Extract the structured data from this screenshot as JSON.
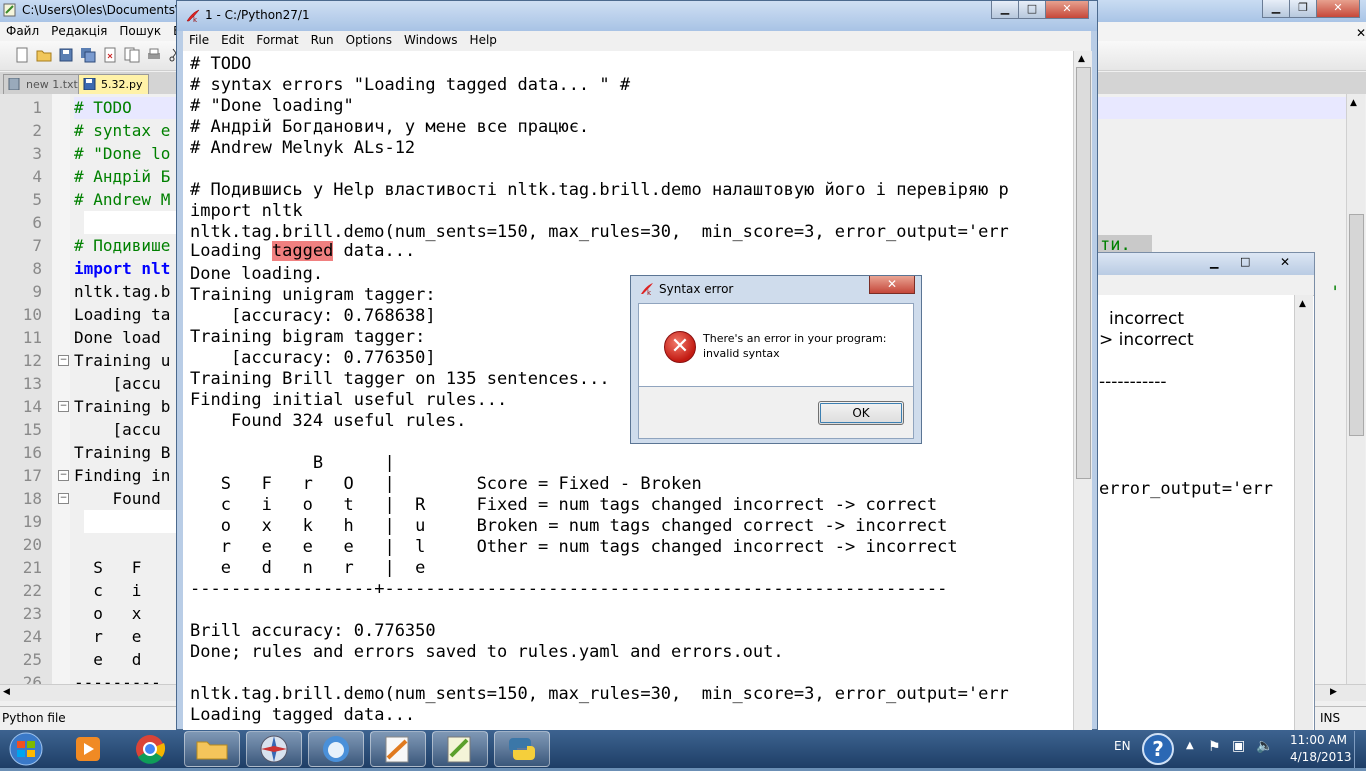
{
  "notepad": {
    "title": "C:\\Users\\Oles\\Documents\\Gi",
    "menu": [
      "Файл",
      "Редакція",
      "Пошук",
      "Ви"
    ],
    "tabs": [
      {
        "label": "new 1.txt"
      },
      {
        "label": "5.32.py"
      }
    ],
    "line_numbers": [
      "1",
      "2",
      "3",
      "4",
      "5",
      "6",
      "7",
      "8",
      "9",
      "10",
      "11",
      "12",
      "13",
      "14",
      "15",
      "16",
      "17",
      "18",
      "19",
      "20",
      "21",
      "22",
      "23",
      "24",
      "25",
      "26"
    ],
    "code_lines": [
      "# TODO",
      "# syntax e",
      "# \"Done lo",
      "# Андрій Б",
      "# Andrew M",
      "",
      "# Подивише",
      "import nlt",
      "nltk.tag.b",
      "Loading ta",
      "Done load",
      "Training u",
      "    [accu",
      "Training b",
      "    [accu",
      "Training B",
      "Finding in",
      "    Found",
      "",
      "",
      "  S   F",
      "  c   i",
      "  o   x",
      "  r   e",
      "  e   d",
      "---------"
    ],
    "status_left": "Python file",
    "status_right": "INS"
  },
  "shell2": {
    "lines": [
      "ти.",
      "'",
      "incorrect",
      "> incorrect",
      "-----------",
      "error_output='err"
    ]
  },
  "idle": {
    "title": "1 - C:/Python27/1",
    "menu": [
      "File",
      "Edit",
      "Format",
      "Run",
      "Options",
      "Windows",
      "Help"
    ],
    "lines": [
      "# TODO",
      "# syntax errors \"Loading tagged data... \" #",
      "# \"Done loading\"",
      "# Андрій Богданович, у мене все працює.",
      "# Andrew Melnyk ALs-12",
      "",
      "# Подившись у Help властивості nltk.tag.brill.demo налаштовую його і перевіряю р",
      "import nltk",
      "nltk.tag.brill.demo(num_sents=150, max_rules=30,  min_score=3, error_output='err",
      "",
      "Done loading.",
      "Training unigram tagger:",
      "    [accuracy: 0.768638]",
      "Training bigram tagger:",
      "    [accuracy: 0.776350]",
      "Training Brill tagger on 135 sentences...",
      "Finding initial useful rules...",
      "    Found 324 useful rules.",
      "",
      "            B      |",
      "   S   F   r   O   |        Score = Fixed - Broken",
      "   c   i   o   t   |  R     Fixed = num tags changed incorrect -> correct",
      "   o   x   k   h   |  u     Broken = num tags changed correct -> incorrect",
      "   r   e   e   e   |  l     Other = num tags changed incorrect -> incorrect",
      "   e   d   n   r   |  e",
      "------------------+-------------------------------------------------------",
      "",
      "Brill accuracy: 0.776350",
      "Done; rules and errors saved to rules.yaml and errors.out.",
      "",
      "nltk.tag.brill.demo(num_sents=150, max_rules=30,  min_score=3, error_output='err",
      "Loading tagged data..."
    ],
    "loading_prefix": "Loading ",
    "loading_highlight": "tagged",
    "loading_suffix": " data..."
  },
  "dialog": {
    "title": "Syntax error",
    "message_line1": "There's an error in your program:",
    "message_line2": "invalid syntax",
    "ok_label": "OK"
  },
  "taskbar": {
    "language": "EN",
    "time": "11:00 AM",
    "date": "4/18/2013"
  },
  "colors": {
    "comment": "#008000",
    "keyword": "#0000ff",
    "highlight": "#f08080",
    "taskbar": "#2a4b78"
  }
}
